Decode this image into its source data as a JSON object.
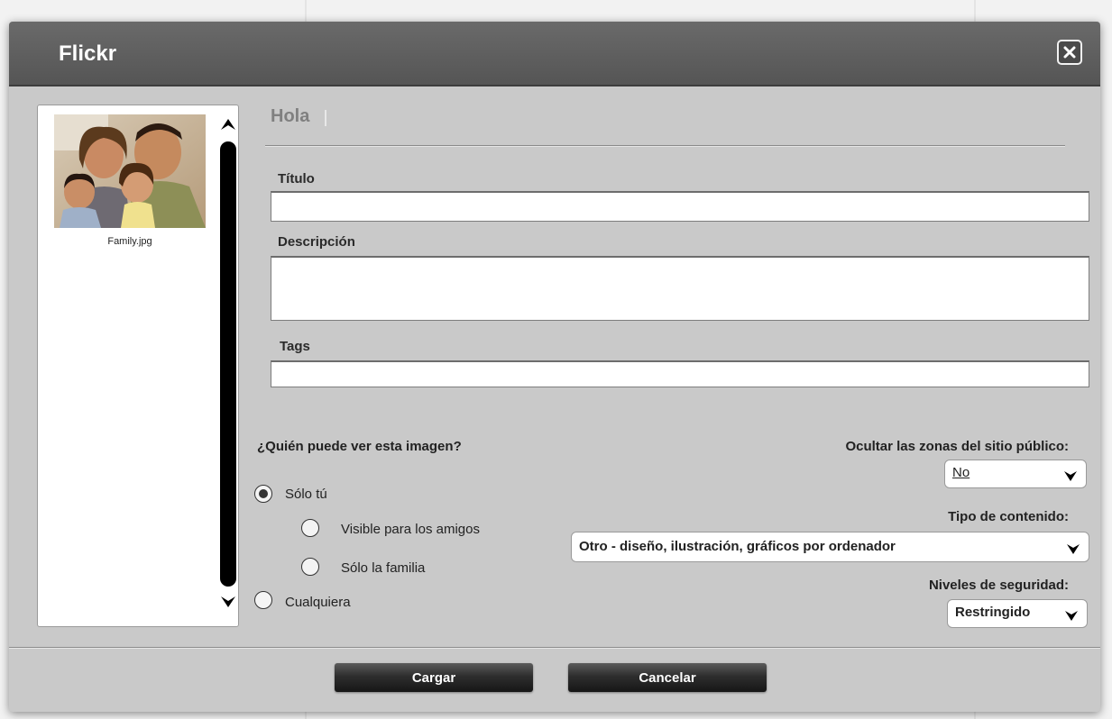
{
  "dialog": {
    "title": "Flickr",
    "close_icon": "close-icon"
  },
  "photo_list": {
    "items": [
      {
        "file_name": "Family.jpg"
      }
    ],
    "scroll_up_icon": "arrow-up-icon",
    "scroll_down_icon": "arrow-down-icon"
  },
  "greeting": "Hola",
  "form": {
    "title_label": "Título",
    "title_value": "",
    "description_label": "Descripción",
    "description_value": "",
    "tags_label": "Tags",
    "tags_value": ""
  },
  "visibility": {
    "question": "¿Quién puede ver esta imagen?",
    "options": [
      {
        "label": "Sólo tú",
        "checked": true
      },
      {
        "label": "Visible para los amigos",
        "checked": false
      },
      {
        "label": "Sólo la familia",
        "checked": false
      },
      {
        "label": "Cualquiera",
        "checked": false
      }
    ]
  },
  "settings": {
    "hide_label": "Ocultar las zonas del sitio público:",
    "hide_value": "No",
    "content_type_label": "Tipo de contenido:",
    "content_type_value": "Otro - diseño, ilustración, gráficos por ordenador",
    "safety_label": "Niveles de seguridad:",
    "safety_value": "Restringido"
  },
  "buttons": {
    "upload": "Cargar",
    "cancel": "Cancelar"
  }
}
